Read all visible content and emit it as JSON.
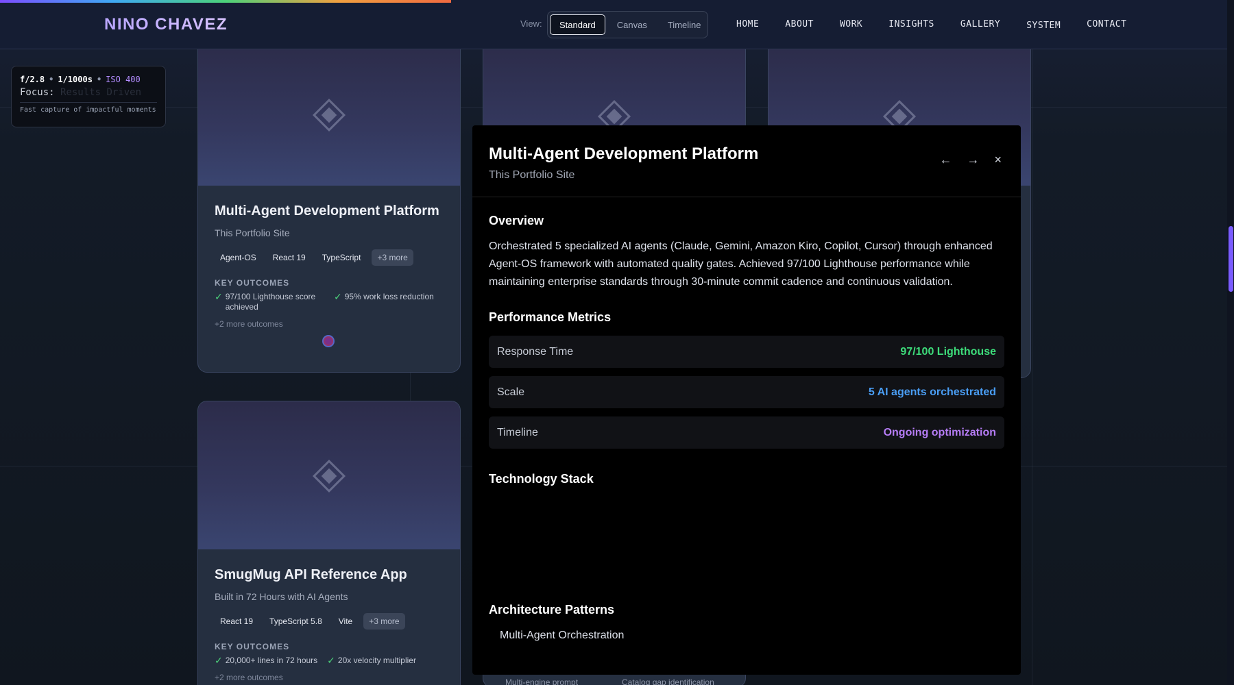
{
  "brand": {
    "name": "NINO CHAVEZ"
  },
  "view_toggle": {
    "label": "View:",
    "options": [
      "Standard",
      "Canvas",
      "Timeline"
    ],
    "active": "Standard"
  },
  "nav": {
    "items": [
      "HOME",
      "ABOUT",
      "WORK",
      "INSIGHTS",
      "GALLERY",
      "SYSTEM",
      "CONTACT"
    ]
  },
  "exposure": {
    "aperture": "f/2.8",
    "shutter": "1/1000s",
    "iso": "ISO 400",
    "focus_label": "Focus:",
    "focus_value": "Results Driven",
    "description": "Fast capture of impactful moments"
  },
  "cards": [
    {
      "title": "Multi-Agent Development Platform",
      "subtitle": "This Portfolio Site",
      "tags": [
        "Agent-OS",
        "React 19",
        "TypeScript"
      ],
      "more_tags": "+3 more",
      "key_outcomes_label": "KEY OUTCOMES",
      "outcomes": [
        "97/100 Lighthouse score achieved",
        "95% work loss reduction"
      ],
      "more_outcomes": "+2 more outcomes"
    },
    {
      "title": "SmugMug API Reference App",
      "subtitle": "Built in 72 Hours with AI Agents",
      "tags": [
        "React 19",
        "TypeScript 5.8",
        "Vite"
      ],
      "more_tags": "+3 more",
      "key_outcomes_label": "KEY OUTCOMES",
      "outcomes": [
        "20,000+ lines in 72 hours",
        "20x velocity multiplier"
      ],
      "more_outcomes": "+2 more outcomes"
    }
  ],
  "peek": {
    "left": "Multi-engine prompt",
    "right": "Catalog gap identification"
  },
  "modal": {
    "title": "Multi-Agent Development Platform",
    "subtitle": "This Portfolio Site",
    "controls": {
      "prev": "←",
      "next": "→",
      "close": "×"
    },
    "overview_heading": "Overview",
    "overview_text": "Orchestrated 5 specialized AI agents (Claude, Gemini, Amazon Kiro, Copilot, Cursor) through enhanced Agent-OS framework with automated quality gates. Achieved 97/100 Lighthouse performance while maintaining enterprise standards through 30-minute commit cadence and continuous validation.",
    "metrics_heading": "Performance Metrics",
    "metrics": [
      {
        "label": "Response Time",
        "value": "97/100 Lighthouse",
        "color": "#3ddc7a"
      },
      {
        "label": "Scale",
        "value": "5 AI agents orchestrated",
        "color": "#4a9ef5"
      },
      {
        "label": "Timeline",
        "value": "Ongoing optimization",
        "color": "#b57cf5"
      }
    ],
    "tech_heading": "Technology Stack",
    "arch_heading": "Architecture Patterns",
    "arch_items": [
      "Multi-Agent Orchestration"
    ]
  }
}
